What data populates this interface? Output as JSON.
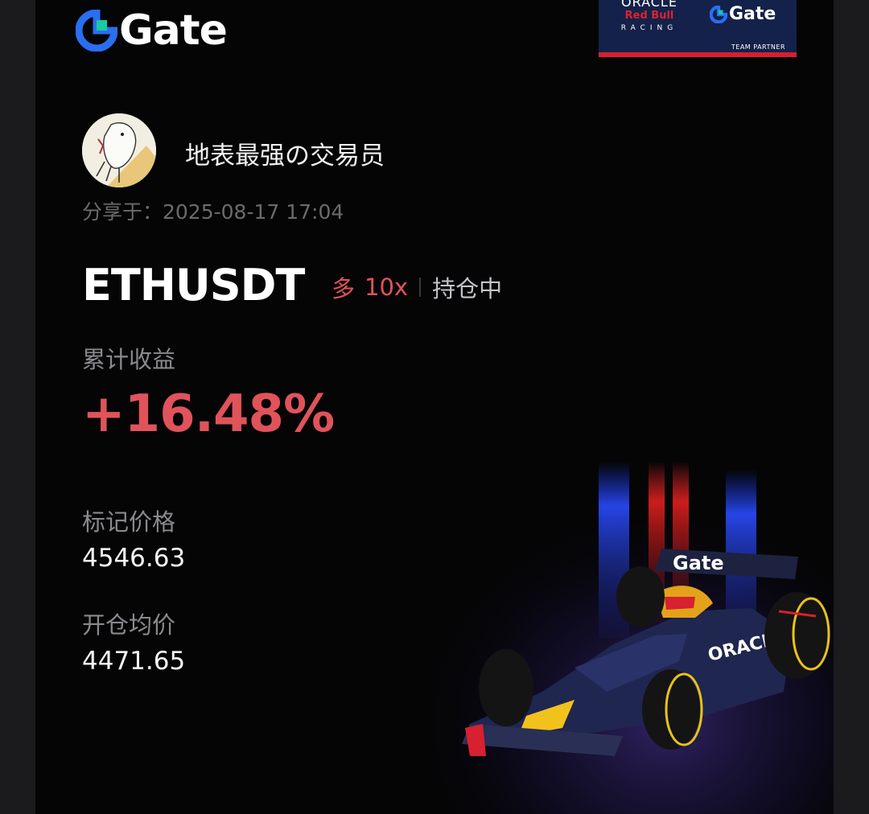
{
  "brand": {
    "name": "Gate",
    "accent": "#2a6ef2",
    "accent2": "#19c9a0"
  },
  "partner_badge": {
    "oracle": "ORACLE",
    "redbull": "Red Bull",
    "racing": "RACING",
    "gate": "Gate",
    "team_partner": "TEAM PARTNER"
  },
  "user": {
    "name": "地表最强の交易员",
    "avatar": "avatar-illustration"
  },
  "shared_at": "分享于：2025-08-17 17:04",
  "position": {
    "pair": "ETHUSDT",
    "side": "多",
    "leverage": "10x",
    "status": "持仓中"
  },
  "pnl": {
    "label": "累计收益",
    "value": "+16.48%",
    "color": "#e0535b"
  },
  "mark_price": {
    "label": "标记价格",
    "value": "4546.63"
  },
  "entry_price": {
    "label": "开仓均价",
    "value": "4471.65"
  }
}
